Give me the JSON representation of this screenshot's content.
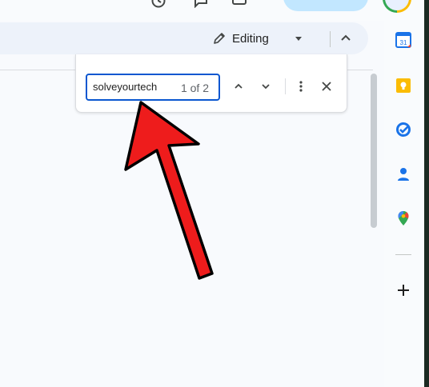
{
  "toolbar": {
    "mode_label": "Editing"
  },
  "find": {
    "query": "solveyourtech",
    "match_count": "1 of 2"
  },
  "icons": {
    "top": [
      "history-icon",
      "comment-icon",
      "video-call-icon"
    ],
    "side_panel": [
      "calendar-icon",
      "keep-icon",
      "tasks-icon",
      "contacts-icon",
      "maps-icon",
      "add-icon"
    ]
  },
  "colors": {
    "accent": "#0b57d0",
    "share_button": "#c2e7ff",
    "toolbar_bg": "#edf2fa",
    "annotation_arrow": "#ee1c1c"
  },
  "side_panel": {
    "calendar_day": "31"
  }
}
